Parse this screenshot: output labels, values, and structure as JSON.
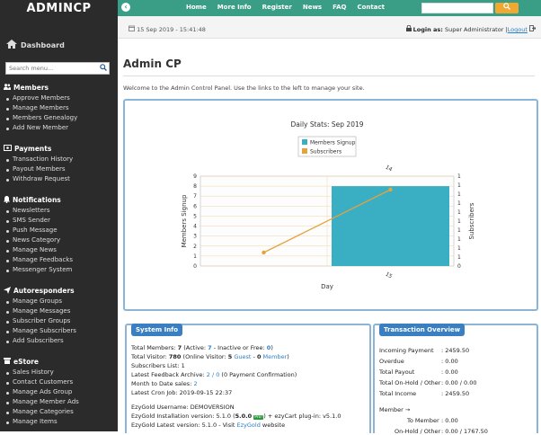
{
  "brand": "ADMINCP",
  "sidebar": {
    "dashboard": "Dashboard",
    "search_placeholder": "Search menu...",
    "sections": [
      {
        "title": "Members",
        "icon": "users-icon",
        "items": [
          "Approve Members",
          "Manage Members",
          "Members Genealogy",
          "Add New Member"
        ]
      },
      {
        "title": "Payments",
        "icon": "money-icon",
        "items": [
          "Transaction History",
          "Payout Members",
          "Withdraw Request"
        ]
      },
      {
        "title": "Notifications",
        "icon": "bell-icon",
        "items": [
          "Newsletters",
          "SMS Sender",
          "Push Message",
          "News Category",
          "Manage News",
          "Manage Feedbacks",
          "Messenger System"
        ]
      },
      {
        "title": "Autoresponders",
        "icon": "send-icon",
        "items": [
          "Manage Groups",
          "Manage Messages",
          "Subscriber Groups",
          "Manage Subscribers",
          "Add Subscribers"
        ]
      },
      {
        "title": "eStore",
        "icon": "store-icon",
        "items": [
          "Sales History",
          "Contact Customers",
          "Manage Ads Group",
          "Manage Member Ads",
          "Manage Categories",
          "Manage Items"
        ]
      }
    ]
  },
  "topnav": {
    "items": [
      "Home",
      "More Info",
      "Register",
      "News",
      "FAQ",
      "Contact"
    ]
  },
  "infobar": {
    "date": "15 Sep 2019 - 15:41:48",
    "login_label": "Login as:",
    "login_user": "Super Administrator",
    "separator": "|",
    "logout": "Logout"
  },
  "page": {
    "title": "Admin CP",
    "welcome": "Welcome to the Admin Control Panel. Use the links to the left to manage your site."
  },
  "chart_data": {
    "type": "bar",
    "title": "Daily Stats: Sep 2019",
    "xlabel": "Day",
    "ylabel": "Members Signup",
    "y2label": "Subscribers",
    "ylim": [
      0,
      9
    ],
    "y2lim": [
      0,
      1
    ],
    "x_top_label": "14",
    "x_bottom_label": "15",
    "legend_position": "top-center",
    "categories": [
      "14",
      "15"
    ],
    "series": [
      {
        "name": "Members Signup",
        "type": "bar",
        "values": [
          0,
          8
        ],
        "color": "#3aafc4"
      },
      {
        "name": "Subscribers",
        "type": "line",
        "values": [
          0.15,
          0.85
        ],
        "color": "#e6a23c"
      }
    ]
  },
  "system_info": {
    "title": "System Info",
    "total_members": "Total Members: ",
    "total_members_val": "7",
    "active_open": " (Active: ",
    "active_val": "7",
    "inactive_text": " - Inactive or Free: ",
    "inactive_val": "0",
    "close": ")",
    "total_visitor": "Total Visitor: ",
    "total_visitor_val": "780",
    "online_open": " (Online Visitor: ",
    "online_val": "5",
    "guest": " Guest",
    "dash": " - ",
    "member_val": "0",
    "member": " Member",
    "subscribers": "Subscribers List: 1",
    "feedback_prefix": "Latest Feedback Archive: ",
    "feedback_link": "2 / 0",
    "feedback_suffix": " (0 Payment Confirmation)",
    "month_prefix": "Month to Date sales: ",
    "month_link": "2",
    "cron": "Latest Cron Job: 2019-09-15 22:37",
    "username": "EzyGold Username: DEMOVERSION",
    "version_prefix": "EzyGold Installation version: 5.1.0 (",
    "version_bold": "5.0.0",
    "version_badge": "Pro!",
    "version_suffix": ") + ezyCart plug-in: v5.1.0",
    "latest_prefix": "EzyGold Latest version: 5.1.0 - Visit ",
    "latest_link": "EzyGold",
    "latest_suffix": " website"
  },
  "transaction": {
    "title": "Transaction Overview",
    "rows": [
      {
        "label": "Incoming Payment",
        "value": ": 2459.50"
      },
      {
        "label": "Overdue",
        "value": ": 0.00"
      },
      {
        "label": "Total Payout",
        "value": ": 0.00"
      },
      {
        "label": "Total On-Hold / Other",
        "value": ": 0.00 / 0.00"
      },
      {
        "label": "Total Income",
        "value": ": 2459.50"
      }
    ],
    "member_label": "Member →",
    "to_member_label": "To Member",
    "to_member_value": ": 0.00",
    "onhold_label": "On-Hold / Other",
    "onhold_value": ": 0.00 / 1767.50"
  }
}
